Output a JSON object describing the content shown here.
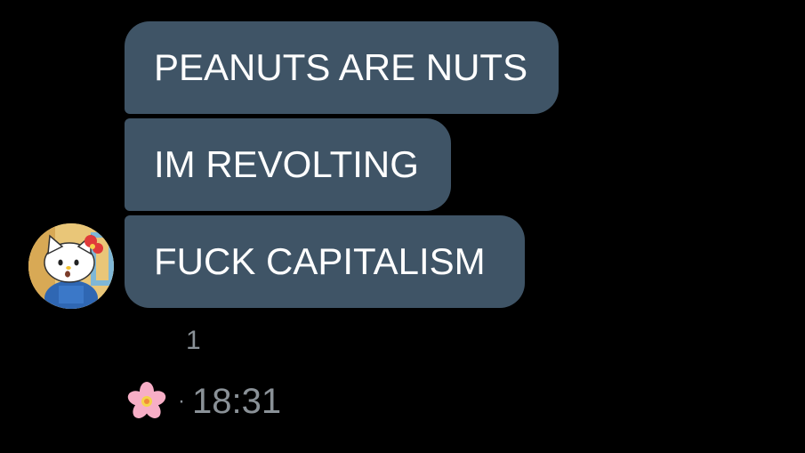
{
  "messages": [
    {
      "text": "PEANUTS ARE NUTS"
    },
    {
      "text": "IM REVOLTING"
    },
    {
      "text": "FUCK CAPITALISM"
    }
  ],
  "reaction_count": "1",
  "footer": {
    "reaction_icon": "cherry-blossom-icon",
    "separator": "·",
    "time": "18:31"
  },
  "avatar": {
    "icon": "hello-kitty-avatar"
  },
  "colors": {
    "background": "#000000",
    "bubble": "#3f5466",
    "bubble_text": "#ffffff",
    "meta_text": "#8a9197"
  }
}
